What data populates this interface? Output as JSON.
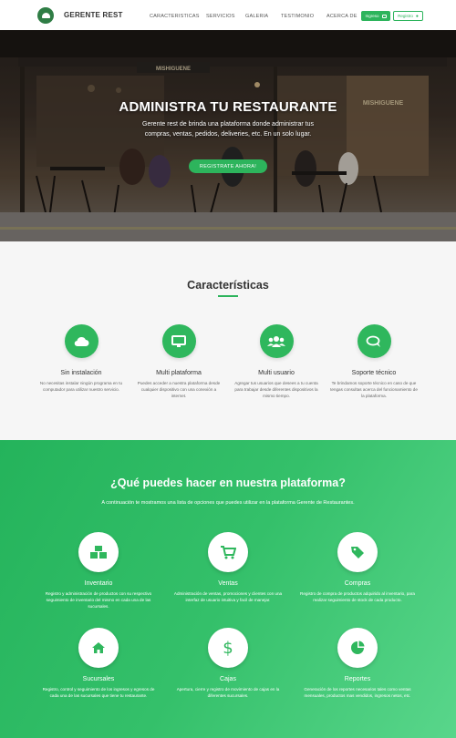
{
  "nav": {
    "brand": "GERENTE REST",
    "menu": [
      "CARACTERISTICAS",
      "SERVICIOS",
      "GALERIA",
      "TESTIMONIO",
      "ACERCA DE"
    ],
    "login_label": "Ingreso",
    "register_label": "Registro"
  },
  "hero": {
    "sign_text": "MISHIGUENE",
    "sign_text_right": "MISHIGUENE",
    "title": "ADMINISTRA TU RESTAURANTE",
    "subtitle": "Gerente rest de brinda una plataforma donde administrar tus compras, ventas, pedidos, deliveries, etc. En un solo lugar.",
    "cta_label": "REGISTRATE AHORA!"
  },
  "features": {
    "title": "Características",
    "items": [
      {
        "title": "Sin instalación",
        "desc": "No necesitas instalar ningún programa en tu computador para utilizar nuestro servicio.",
        "icon": "cloud-icon"
      },
      {
        "title": "Multi plataforma",
        "desc": "Puedes acceder a nuestra plataforma desde cualquier dispositivo con una conexión a internet.",
        "icon": "monitor-icon"
      },
      {
        "title": "Multi usuario",
        "desc": "Agregar tus usuarios que desees a tu cuenta para trabajar desde diferentes dispositivos la mismo tiempo.",
        "icon": "users-icon"
      },
      {
        "title": "Soporte técnico",
        "desc": "Te brindamos soporte técnico en caso de que tengas consultas acerca del funcionamiento de la plataforma.",
        "icon": "chat-icon"
      }
    ]
  },
  "platform": {
    "title": "¿Qué puedes hacer en nuestra plataforma?",
    "subtitle": "A continuación te mostramos una lista de opciones que puedes utilizar en la plataforma Gerente de Restaurantes.",
    "items": [
      {
        "title": "Inventario",
        "desc": "Registro y administración de productos con su respectivo seguimiento de inventario del mismo en cada una de las sucursales.",
        "icon": "boxes-icon"
      },
      {
        "title": "Ventas",
        "desc": "Administración de ventas, promociones y clientes con una interfaz de usuario intuitiva y facil de manejar.",
        "icon": "cart-icon"
      },
      {
        "title": "Compras",
        "desc": "Registro de compra de productos adquirido al inventario, para realizar seguimiento de stock de cada producto.",
        "icon": "tag-icon"
      },
      {
        "title": "Sucursales",
        "desc": "Registro, control y seguimiento de los ingresos y egresos de cada una de las sucursales que tiene tu restaurante.",
        "icon": "home-icon"
      },
      {
        "title": "Cajas",
        "desc": "Apertura, cierre y registro de movimiento de cajas en la diferentes sucursales.",
        "icon": "dollar-icon"
      },
      {
        "title": "Reportes",
        "desc": "Generación de los reportes necesarios tales como ventas mensuales, productos mas vendidos, ingresos netos, etc.",
        "icon": "pie-chart-icon"
      }
    ]
  },
  "colors": {
    "accent": "#2db45c"
  }
}
